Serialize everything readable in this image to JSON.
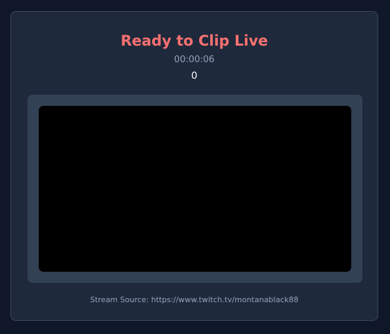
{
  "status": {
    "title": "Ready to Clip Live",
    "timer": "00:00:06",
    "clip_count": "0"
  },
  "player": {
    "state": "empty"
  },
  "footer": {
    "source_text": "Stream Source: https://www.twitch.tv/montanablack88"
  },
  "colors": {
    "background": "#0f1729",
    "card": "#1e293b",
    "accent": "#f87171",
    "muted_text": "#94a3b8",
    "player_frame": "#334155",
    "video": "#000000"
  }
}
